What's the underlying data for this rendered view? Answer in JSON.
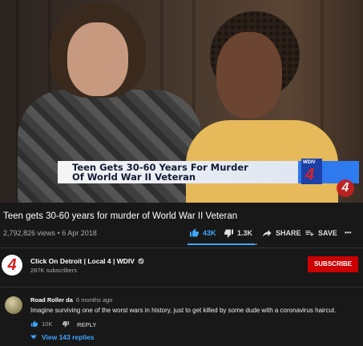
{
  "video": {
    "headline": "Teen Gets 30-60 Years For Murder Of World War II Veteran",
    "station_small": "WDIV",
    "station_number": "4",
    "bug_number": "4"
  },
  "title": "Teen gets 30-60 years for murder of World War II Veteran",
  "meta": "2,792,826 views • 6 Apr 2018",
  "actions": {
    "likes": "43K",
    "dislikes": "1.3K",
    "share": "SHARE",
    "save": "SAVE",
    "more": "•••",
    "like_ratio": 0.97
  },
  "channel": {
    "logo": "4",
    "name": "Click On Detroit | Local 4 | WDIV",
    "verified_icon": "check-circle-icon",
    "subscribers": "287K subscribers",
    "subscribe_label": "SUBSCRIBE"
  },
  "comment": {
    "author": "Road Roller da",
    "time": "6 months ago",
    "text": "Imagine surviving one of the worst wars in history, just to get killed by some dude with a coronavirus haircut.",
    "likes": "10K",
    "reply_label": "REPLY",
    "view_replies": "View 143 replies"
  },
  "colors": {
    "background": "#181818",
    "accent_blue": "#3ea6ff",
    "subscribe_red": "#cc0000"
  }
}
